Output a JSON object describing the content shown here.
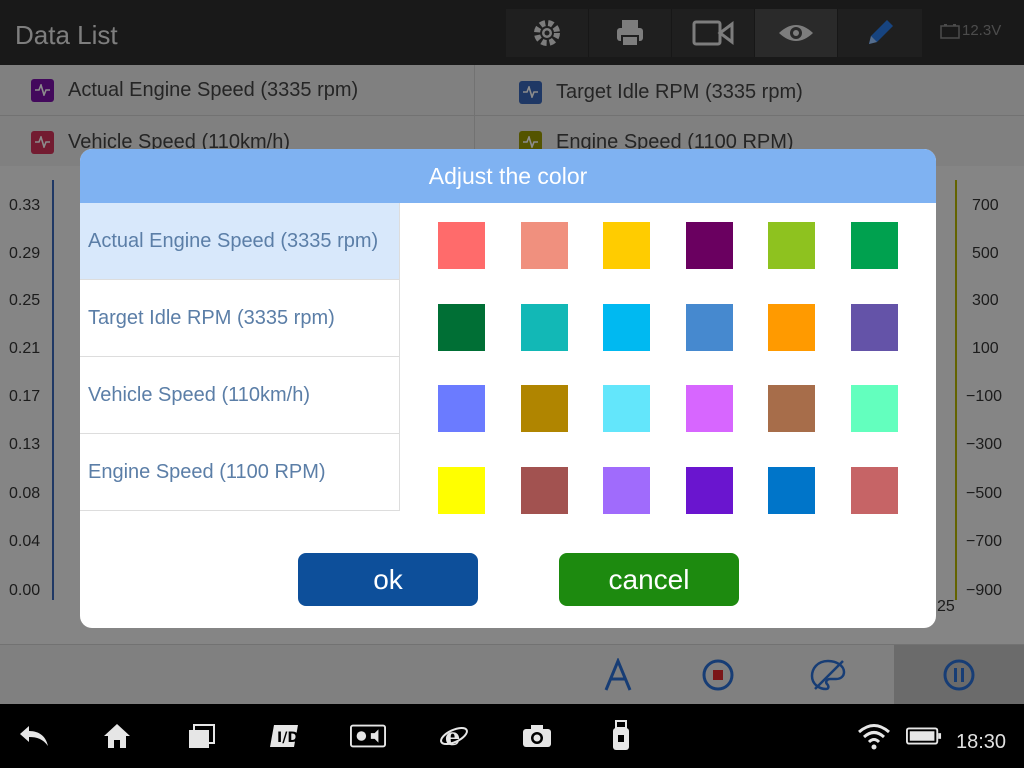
{
  "app": {
    "title": "Data List"
  },
  "toolbar": {
    "tools": [
      "settings-icon",
      "printer-icon",
      "video-camera-icon",
      "eye-icon",
      "pencil-icon"
    ],
    "battery": "12.3V"
  },
  "legend": [
    {
      "label": "Actual Engine Speed (3335 rpm)",
      "color": "#7b12a8"
    },
    {
      "label": "Target Idle RPM  (3335 rpm)",
      "color": "#3a66b8"
    },
    {
      "label": "Vehicle Speed  (110km/h)",
      "color": "#d2335a"
    },
    {
      "label": "Engine Speed  (1100 RPM)",
      "color": "#9a9a00"
    }
  ],
  "chart_axes": {
    "left_ticks": [
      "0.33",
      "0.29",
      "0.25",
      "0.21",
      "0.17",
      "0.13",
      "0.08",
      "0.04",
      "0.00"
    ],
    "right_ticks": [
      "700",
      "500",
      "300",
      "100",
      "−100",
      "−300",
      "−500",
      "−700",
      "−900"
    ],
    "x_tick_right": "25"
  },
  "dialog": {
    "title": "Adjust the color",
    "items": [
      "Actual Engine Speed (3335 rpm)",
      "Target Idle RPM  (3335 rpm)",
      "Vehicle Speed  (110km/h)",
      "Engine Speed  (1100 RPM)"
    ],
    "selected_index": 0,
    "palette": [
      [
        "#ff6b6b",
        "#f0907e",
        "#ffcc00",
        "#6a0060",
        "#8ec21f",
        "#00a14f"
      ],
      [
        "#006f35",
        "#12b8b6",
        "#00b9f1",
        "#4689cf",
        "#ff9a00",
        "#6453a8"
      ],
      [
        "#6b7bff",
        "#b08500",
        "#63e6fb",
        "#d766ff",
        "#a76d4a",
        "#63ffbe"
      ],
      [
        "#ffff00",
        "#a25250",
        "#a06bfc",
        "#6a15cf",
        "#0075c9",
        "#c66466"
      ]
    ],
    "ok_label": "ok",
    "cancel_label": "cancel"
  },
  "bottom_tools": [
    "font-a-icon",
    "record-stop-icon",
    "palette-off-icon",
    "pause-icon"
  ],
  "nav": {
    "icons": [
      "back-icon",
      "home-icon",
      "recent-apps-icon",
      "launcher-icon",
      "brightness-volume-icon",
      "browser-icon",
      "camera-icon",
      "usb-drive-icon"
    ],
    "time": "18:30"
  }
}
